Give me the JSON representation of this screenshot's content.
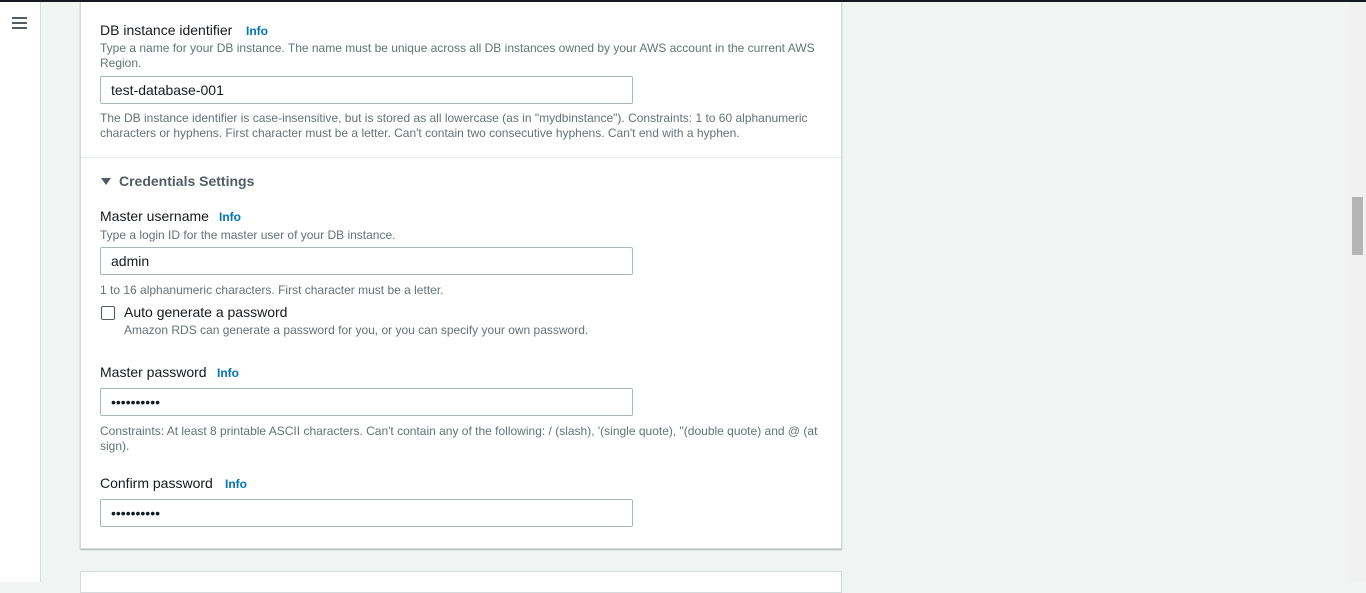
{
  "menu": {
    "icon": "hamburger-menu-icon"
  },
  "db_instance": {
    "label": "DB instance identifier",
    "info": "Info",
    "description": "Type a name for your DB instance. The name must be unique across all DB instances owned by your AWS account in the current AWS Region.",
    "value": "test-database-001",
    "constraints": "The DB instance identifier is case-insensitive, but is stored as all lowercase (as in \"mydbinstance\"). Constraints: 1 to 60 alphanumeric characters or hyphens. First character must be a letter. Can't contain two consecutive hyphens. Can't end with a hyphen."
  },
  "credentials": {
    "title": "Credentials Settings",
    "expanded_icon": "caret-down-icon",
    "master_username": {
      "label": "Master username",
      "info": "Info",
      "description": "Type a login ID for the master user of your DB instance.",
      "value": "admin",
      "constraints": "1 to 16 alphanumeric characters. First character must be a letter."
    },
    "auto_generate": {
      "label": "Auto generate a password",
      "description": "Amazon RDS can generate a password for you, or you can specify your own password.",
      "checked": false
    },
    "master_password": {
      "label": "Master password",
      "info": "Info",
      "value": "••••••••••",
      "constraints": "Constraints: At least 8 printable ASCII characters. Can't contain any of the following: / (slash), '(single quote), \"(double quote) and @ (at sign)."
    },
    "confirm_password": {
      "label": "Confirm password",
      "info": "Info",
      "value": "••••••••••"
    }
  },
  "colors": {
    "link": "#0073bb",
    "text": "#16191f",
    "secondary_text": "#687078",
    "border": "#aab7b8",
    "background": "#f2f3f3"
  }
}
